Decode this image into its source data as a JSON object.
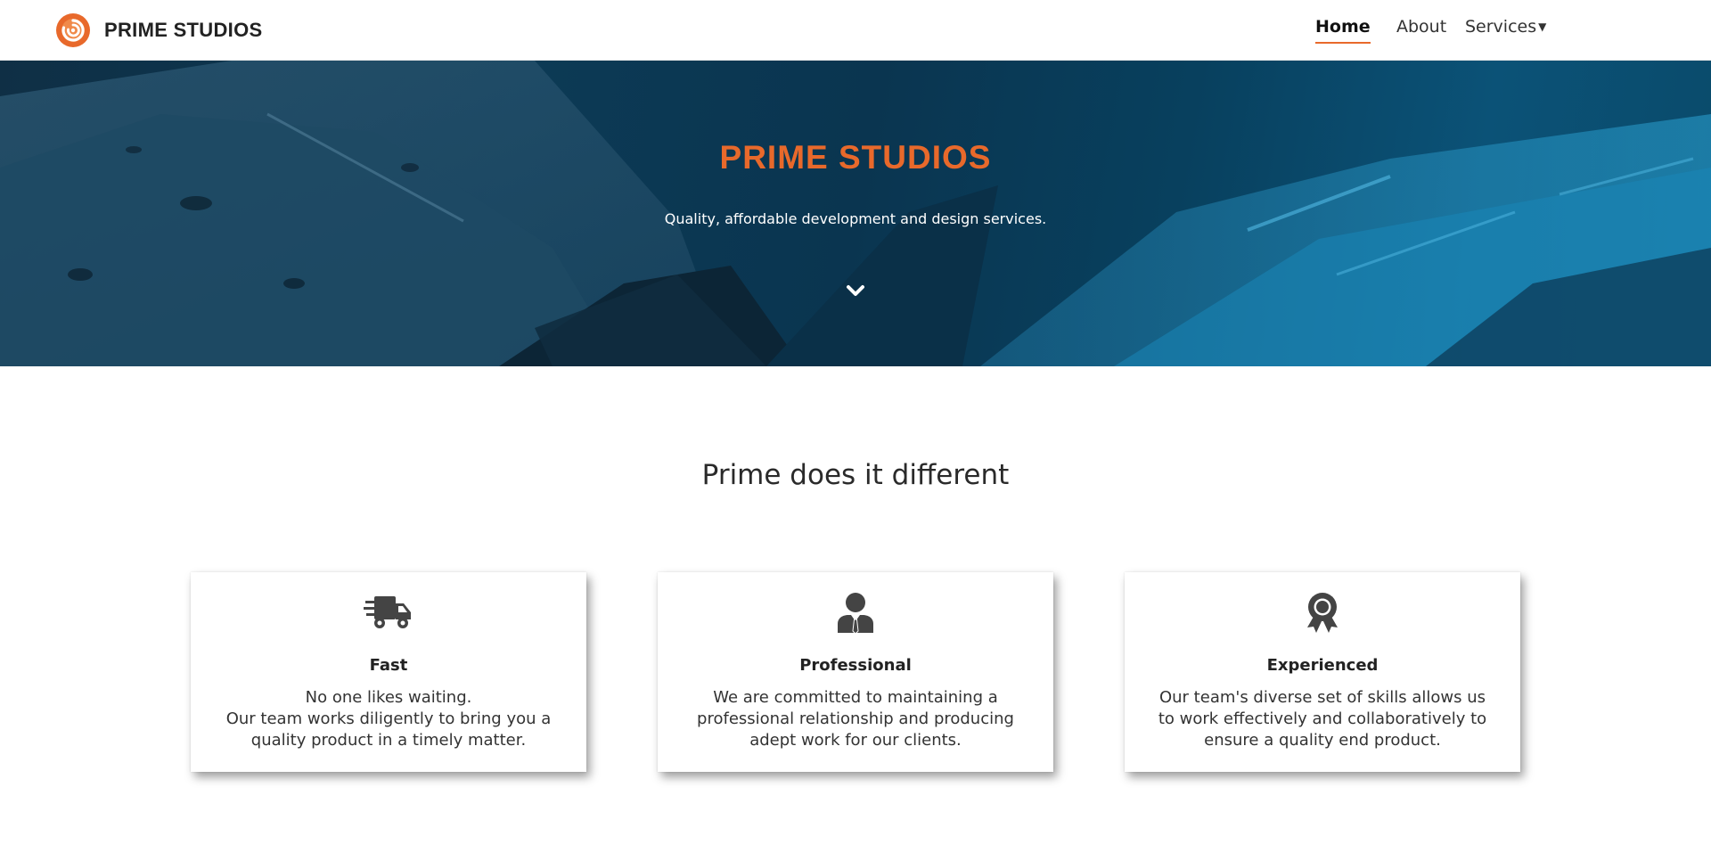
{
  "brand": {
    "name": "PRIME STUDIOS",
    "logo_icon": "spiral-logo-icon",
    "logo_color": "#e8692b"
  },
  "nav": {
    "items": [
      {
        "label": "Home",
        "active": true
      },
      {
        "label": "About",
        "active": false
      },
      {
        "label": "Services",
        "active": false,
        "dropdown": true
      }
    ],
    "caret_icon": "caret-down-icon"
  },
  "hero": {
    "title": "PRIME STUDIOS",
    "subtitle": "Quality, affordable development and design services.",
    "scroll_icon": "chevron-down-icon",
    "title_color": "#e8692b"
  },
  "section": {
    "title": "Prime does it different",
    "cards": [
      {
        "icon": "shipping-fast-truck-icon",
        "title": "Fast",
        "lines": [
          "No one likes waiting.",
          "Our team works diligently to bring you a",
          "quality product in a timely matter."
        ]
      },
      {
        "icon": "user-tie-icon",
        "title": "Professional",
        "lines": [
          "We are committed to maintaining a",
          "professional relationship and producing",
          "adept work for our clients."
        ]
      },
      {
        "icon": "award-ribbon-icon",
        "title": "Experienced",
        "lines": [
          "Our team's diverse set of skills allows us",
          "to work effectively and collaboratively to",
          "ensure a quality end product."
        ]
      }
    ]
  },
  "colors": {
    "accent": "#e8692b",
    "hero_bg": "#0c3a55",
    "icon": "#444444"
  }
}
